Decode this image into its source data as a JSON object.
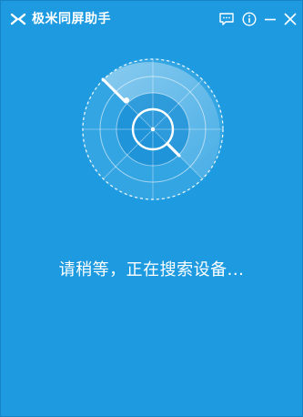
{
  "app": {
    "title": "极米同屏助手",
    "logo_icon": "xgimi-logo-icon"
  },
  "controls": {
    "feedback_icon": "feedback-icon",
    "info_icon": "info-icon",
    "minimize_icon": "minimize-icon",
    "close_icon": "close-icon"
  },
  "radar": {
    "icon": "radar-scan-icon"
  },
  "status": {
    "text": "请稍等，正在搜索设备..."
  },
  "colors": {
    "background": "#1e9be0",
    "foreground": "#ffffff",
    "radar_inner": "#1a8fd6"
  }
}
